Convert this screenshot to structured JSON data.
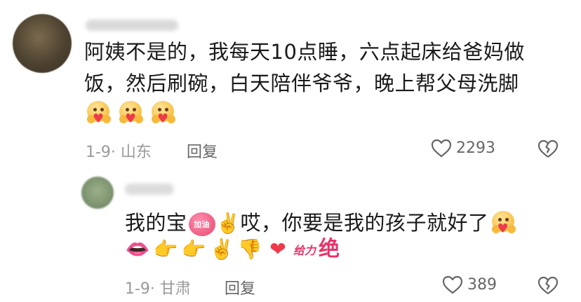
{
  "comment": {
    "text": "阿姨不是的，我每天10点睡，六点起床给爸妈做饭，然后刷碗，白天陪伴爷爷，晚上帮父母洗脚",
    "emojis": [
      "hug-emoji",
      "hug-emoji",
      "hug-emoji"
    ],
    "meta": "1-9· 山东",
    "reply_label": "回复",
    "likes": "2293"
  },
  "reply": {
    "text_part1": "我的宝",
    "badge_text": "加油",
    "text_part2": "哎，你要是我的孩子就好了",
    "emojis": [
      "kiss-lips-emoji",
      "pointing-hand-emoji",
      "pointing-hand-emoji",
      "victory-hand-emoji",
      "thumbs-down-emoji",
      "red-heart-emoji"
    ],
    "geili_text": "给力",
    "jue_text": "绝",
    "meta": "1-9· 甘肃",
    "reply_label": "回复",
    "likes": "389"
  },
  "colors": {
    "heart": "#ee3a4a",
    "accent_pink": "#e8336a",
    "meta_gray": "#9a9a9a"
  }
}
